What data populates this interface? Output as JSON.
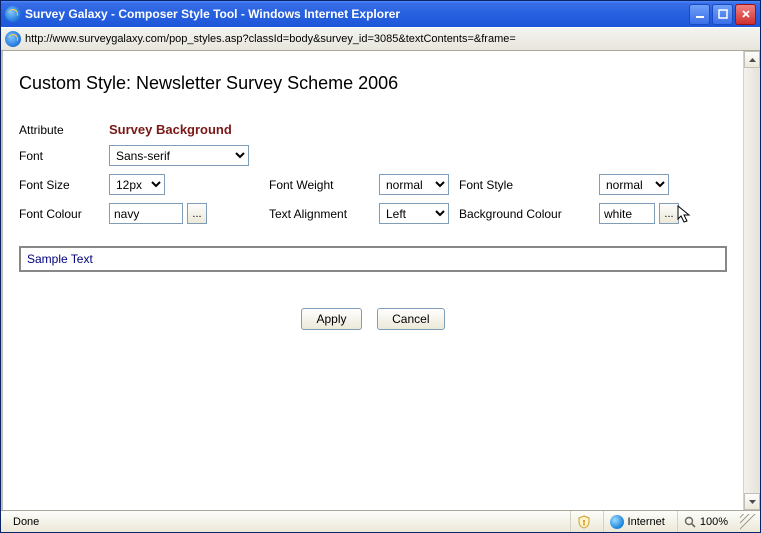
{
  "window": {
    "title": "Survey Galaxy - Composer Style Tool - Windows Internet Explorer",
    "url": "http://www.surveygalaxy.com/pop_styles.asp?classId=body&survey_id=3085&textContents=&frame="
  },
  "page": {
    "heading": "Custom Style: Newsletter Survey Scheme 2006",
    "labels": {
      "attribute": "Attribute",
      "font": "Font",
      "font_size": "Font Size",
      "font_weight": "Font Weight",
      "font_style": "Font Style",
      "font_colour": "Font Colour",
      "text_alignment": "Text Alignment",
      "background_colour": "Background Colour"
    },
    "attribute_value": "Survey Background",
    "fields": {
      "font": "Sans-serif",
      "font_size": "12px",
      "font_weight": "normal",
      "font_style": "normal",
      "font_colour": "navy",
      "text_alignment": "Left",
      "background_colour": "white"
    },
    "picker_label": "...",
    "sample_text": "Sample Text",
    "buttons": {
      "apply": "Apply",
      "cancel": "Cancel"
    }
  },
  "status": {
    "done": "Done",
    "zone": "Internet",
    "zoom": "100%"
  }
}
